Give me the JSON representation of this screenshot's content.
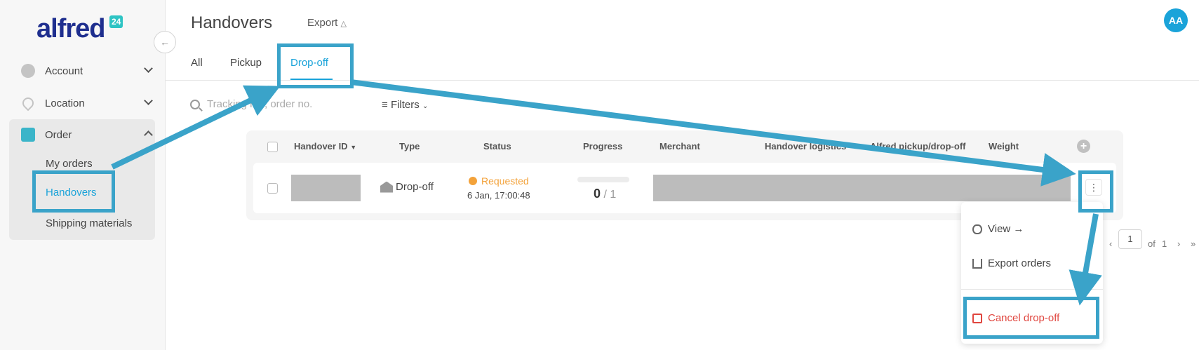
{
  "sidebar": {
    "logo": "alfred",
    "logo_badge": "24",
    "items": [
      {
        "label": "Account"
      },
      {
        "label": "Location"
      },
      {
        "label": "Order"
      }
    ],
    "order_sub": [
      {
        "label": "My orders"
      },
      {
        "label": "Handovers"
      },
      {
        "label": "Shipping materials"
      }
    ],
    "collapse_icon": "arrow-left-icon"
  },
  "header": {
    "title": "Handovers",
    "export_label": "Export",
    "avatar_initials": "AA"
  },
  "tabs": [
    {
      "label": "All"
    },
    {
      "label": "Pickup"
    },
    {
      "label": "Drop-off"
    }
  ],
  "search": {
    "placeholder": "Tracking no., order no."
  },
  "filters": {
    "label": "Filters"
  },
  "table": {
    "columns": [
      "Handover ID",
      "Type",
      "Status",
      "Progress",
      "Merchant",
      "Handover logistics",
      "Alfred pickup/drop-off",
      "Weight"
    ],
    "add_column": "+",
    "rows": [
      {
        "type": "Drop-off",
        "status": "Requested",
        "status_color": "#f3a23a",
        "date": "6 Jan, 17:00:48",
        "progress_done": "0",
        "progress_total": "/ 1",
        "progress_fraction": 0
      }
    ]
  },
  "row_menu": {
    "view": "View →",
    "export": "Export orders",
    "cancel": "Cancel drop-off",
    "icons": [
      "eye-icon",
      "share-icon",
      "archive-icon"
    ]
  },
  "pagination": {
    "prev": "‹",
    "page": "1",
    "of": "of",
    "total": "1",
    "next": "›",
    "last": "»"
  },
  "colors": {
    "accent": "#1aa3d9",
    "annotation": "#3aa3c9",
    "danger": "#e0463f",
    "warning": "#f3a23a"
  }
}
